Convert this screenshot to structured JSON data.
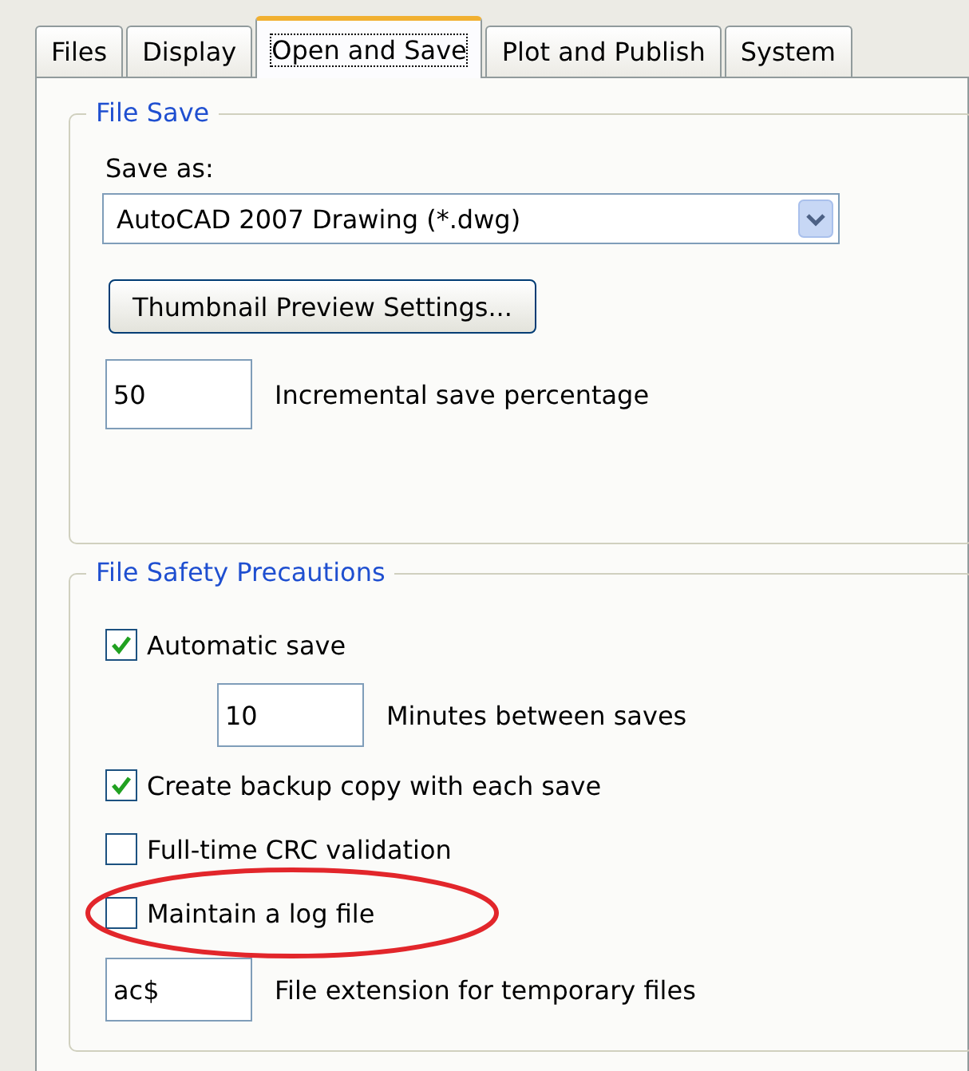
{
  "tabs": [
    {
      "label": "Files",
      "selected": false
    },
    {
      "label": "Display",
      "selected": false
    },
    {
      "label": "Open and Save",
      "selected": true
    },
    {
      "label": "Plot and Publish",
      "selected": false
    },
    {
      "label": "System",
      "selected": false
    }
  ],
  "file_save": {
    "title": "File Save",
    "save_as_label": "Save as:",
    "save_as_value": "AutoCAD 2007 Drawing (*.dwg)",
    "thumbnail_button": "Thumbnail Preview Settings...",
    "incremental_value": "50",
    "incremental_label": "Incremental save percentage"
  },
  "file_safety": {
    "title": "File Safety Precautions",
    "items": [
      {
        "kind": "checkbox",
        "label": "Automatic save",
        "checked": true
      },
      {
        "kind": "field",
        "entry": "10",
        "caption": "Minutes between saves",
        "indented": true
      },
      {
        "kind": "checkbox",
        "label": "Create backup copy with each save",
        "checked": true
      },
      {
        "kind": "checkbox",
        "label": "Full-time CRC validation",
        "checked": false
      },
      {
        "kind": "checkbox",
        "label": "Maintain a log file",
        "checked": false,
        "highlighted": true
      },
      {
        "kind": "field",
        "entry": "ac$",
        "caption": "File extension for temporary files",
        "indented": false
      }
    ]
  }
}
